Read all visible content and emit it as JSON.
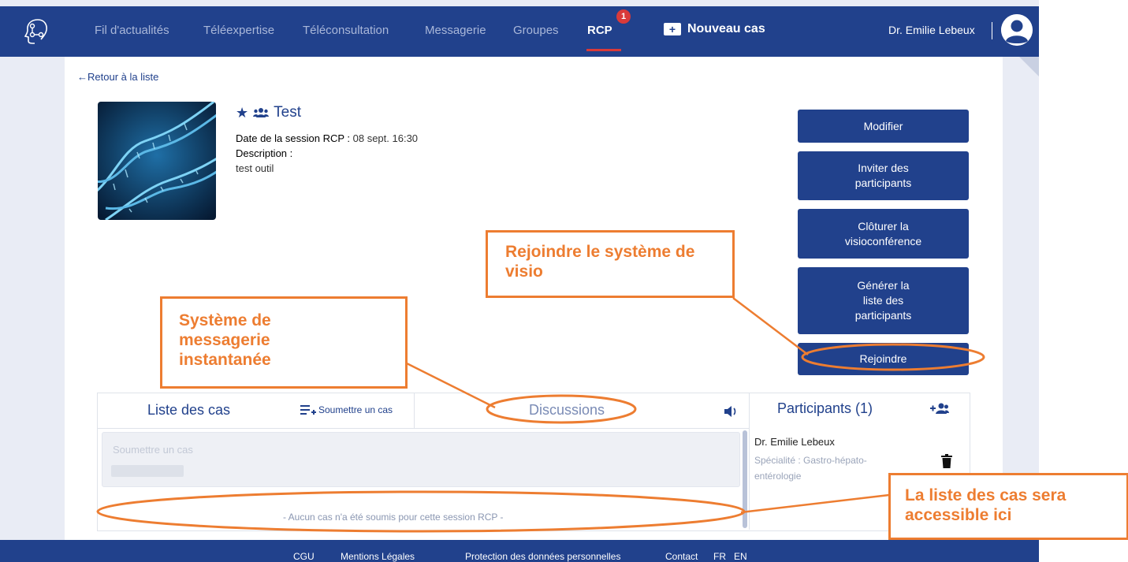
{
  "nav": {
    "items": [
      "Fil d'actualités",
      "Téléexpertise",
      "Téléconsultation",
      "Messagerie",
      "Groupes",
      "RCP"
    ],
    "rcp_badge": "1",
    "new_case": "Nouveau cas",
    "user": "Dr. Emilie Lebeux"
  },
  "back_link": "←Retour à la liste",
  "session": {
    "title": "Test",
    "date_label": "Date de la session RCP :",
    "date_value": "08 sept. 16:30",
    "description_label": "Description :",
    "description": "test outil"
  },
  "actions": [
    "Modifier",
    "Inviter des participants",
    "Clôturer la visioconférence",
    "Générer la liste des participants",
    "Rejoindre"
  ],
  "tabs": {
    "cases": "Liste des cas",
    "submit": "Soumettre un cas",
    "discussions": "Discussions"
  },
  "cases": {
    "placeholder": "Soumettre un cas",
    "empty": "- Aucun cas n'a été soumis pour cette session RCP -"
  },
  "participants": {
    "title": "Participants (1)",
    "list": [
      {
        "name": "Dr. Emilie Lebeux",
        "specialty": "Spécialité : Gastro-hépato-entérologie"
      }
    ]
  },
  "footer": [
    "CGU",
    "Mentions Légales",
    "Protection des données personnelles",
    "Contact",
    "FR",
    "EN"
  ],
  "callouts": {
    "visio": "Rejoindre le système de visio",
    "messaging": "Système de messagerie instantanée",
    "cases": "La liste des cas sera accessible ici"
  },
  "colors": {
    "primary": "#21418c",
    "callout": "#ed7d31",
    "badge": "#d93a3a"
  }
}
